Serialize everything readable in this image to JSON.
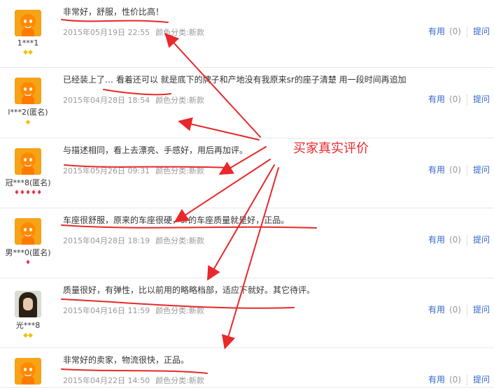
{
  "reviews": [
    {
      "user": "1***1",
      "badges": "◆◆",
      "badge_type": "diamond",
      "avatar": "orange",
      "text": "非常好，舒服，性价比高！",
      "date": "2015年05月19日 22:55",
      "category": "颜色分类:新款",
      "useful": "有用",
      "count": "(0)",
      "ask": "提问"
    },
    {
      "user": "l***2(匿名)",
      "badges": "◆",
      "badge_type": "diamond",
      "avatar": "orange",
      "text": "已经装上了… 看着还可以 就是底下的牌子和产地没有我原来sr的座子清楚 用一段时间再追加",
      "date": "2015年04月28日 18:54",
      "category": "颜色分类:新款",
      "useful": "有用",
      "count": "(0)",
      "ask": "提问"
    },
    {
      "user": "冠***8(匿名)",
      "badges": "♦♦♦♦♦",
      "badge_type": "red",
      "avatar": "orange",
      "text": "与描述相同，看上去漂亮、手感好，用后再加评。",
      "date": "2015年05月26日 09:31",
      "category": "颜色分类:新款",
      "useful": "有用",
      "count": "(0)",
      "ask": "提问"
    },
    {
      "user": "男***0(匿名)",
      "badges": "♦",
      "badge_type": "red",
      "avatar": "orange",
      "text": "车座很舒服，原来的车座很硬，sr的车座质量就是好，正品。",
      "date": "2015年04月28日 18:19",
      "category": "颜色分类:新款",
      "useful": "有用",
      "count": "(0)",
      "ask": "提问"
    },
    {
      "user": "光***8",
      "badges": "◆◆",
      "badge_type": "diamond",
      "avatar": "girl",
      "text": "质量很好，有弹性，比以前用的略略档部，适应下就好。其它待评。",
      "date": "2015年04月16日 11:59",
      "category": "颜色分类:新款",
      "useful": "有用",
      "count": "(0)",
      "ask": "提问"
    },
    {
      "user": "",
      "badges": "",
      "badge_type": "diamond",
      "avatar": "orange",
      "text": "非常好的卖家，物流很快，正品。",
      "date": "2015年04月22日 14:50",
      "category": "颜色分类:新款",
      "useful": "有用",
      "count": "(0)",
      "ask": "提问"
    }
  ],
  "annotation": {
    "label": "买家真实评价",
    "color": "#e8282a"
  },
  "colors": {
    "link": "#3366cc",
    "meta": "#999999",
    "border": "#e8e8e8"
  }
}
